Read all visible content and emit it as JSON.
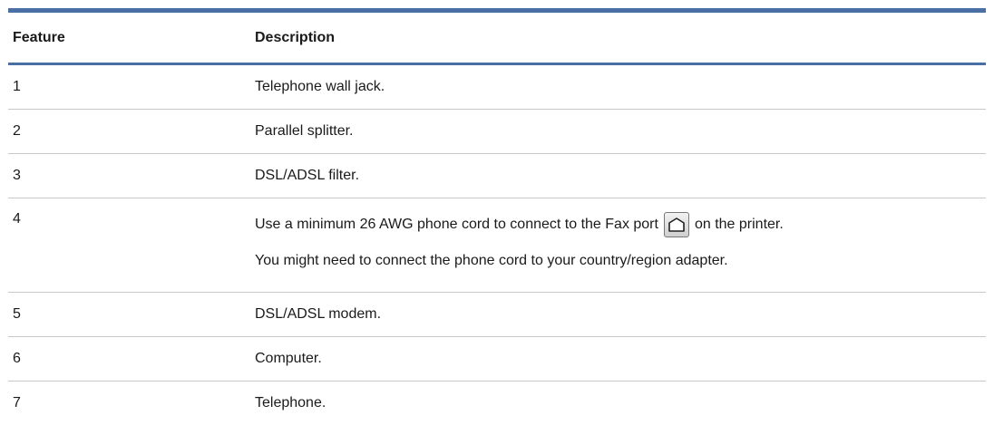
{
  "table": {
    "headers": {
      "feature": "Feature",
      "description": "Description"
    },
    "rows": [
      {
        "feature": "1",
        "description": "Telephone wall jack."
      },
      {
        "feature": "2",
        "description": "Parallel splitter."
      },
      {
        "feature": "3",
        "description": "DSL/ADSL filter."
      },
      {
        "feature": "4",
        "description_before_icon": "Use a minimum 26 AWG phone cord to connect to the Fax port",
        "icon": "fax-port-icon",
        "description_after_icon": "on the printer.",
        "description_note": "You might need to connect the phone cord to your country/region adapter."
      },
      {
        "feature": "5",
        "description": "DSL/ADSL modem."
      },
      {
        "feature": "6",
        "description": "Computer."
      },
      {
        "feature": "7",
        "description": "Telephone."
      }
    ]
  },
  "colors": {
    "rule": "#4a6fa5",
    "row_divider": "#c8c8c8"
  }
}
